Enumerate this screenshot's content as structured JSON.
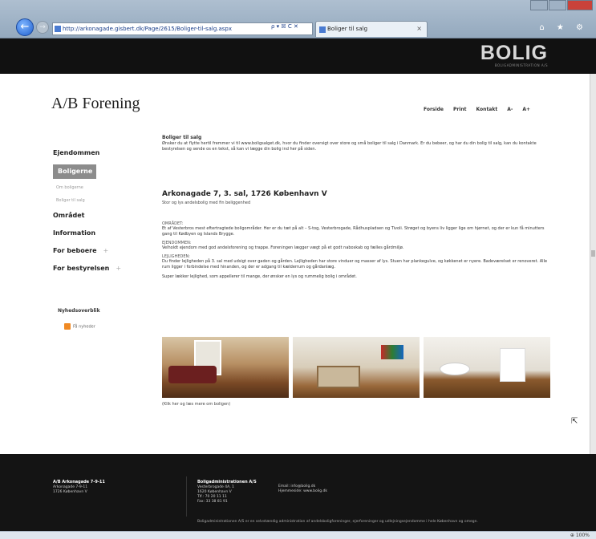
{
  "browser": {
    "back_icon": "back-arrow-icon",
    "forward_icon": "forward-arrow-icon",
    "url": "http://arkonagade.gisbert.dk/Page/2615/Boliger-til-salg.aspx",
    "address_controls": "ρ ▾ ☒ C ✕",
    "tab_title": "Boliger til salg",
    "tab_close": "×",
    "tools": "⌂ ★ ⚙",
    "zoom": "⊕ 100%"
  },
  "header": {
    "brand": "BOLIG",
    "brand_sub": "BOLIGADMINISTRATION A/S"
  },
  "site": {
    "title": "A/B Forening",
    "topnav": [
      "Forside",
      "Print",
      "Kontakt",
      "A-",
      "A+"
    ]
  },
  "sidebar": {
    "items": [
      {
        "label": "Ejendommen",
        "type": "item"
      },
      {
        "label": "Boligerne",
        "type": "active"
      },
      {
        "label": "Om boligerne",
        "type": "sub"
      },
      {
        "label": "Boliger til salg",
        "type": "sub"
      },
      {
        "label": "Området",
        "type": "item"
      },
      {
        "label": "Information",
        "type": "item"
      },
      {
        "label": "For beboere",
        "type": "item",
        "plus": "+"
      },
      {
        "label": "For bestyrelsen",
        "type": "item",
        "plus": "+"
      }
    ],
    "section_title": "Nyhedsoverblik",
    "rss_label": "Få nyheder"
  },
  "content": {
    "intro_title": "Boliger til salg",
    "intro_text": "Ønsker du at flytte hertil fremmer vi til www.boligsalget.dk, hvor du finder oversigt over store og små boliger til salg i Danmark. Er du bebeer, og har du din bolig til salg, kan du kontakte bestyrelsen og sende os en tekst, så kan vi lægge din bolig ind her på siden.",
    "address_title": "Arkonagade 7, 3. sal, 1726 København V",
    "address_sub": "Stor og lys andelsbolig med fin beliggenhed",
    "sections": [
      {
        "label": "OMRÅDET:",
        "text": "Et af Vesterbros mest eftertragtede boligområder. Her er du tæt på alt – S-tog, Vesterbrogade, Rådhuspladsen og Tivoli. Strøget og byens liv ligger lige om hjørnet, og der er kun få minutters gang til Kødbyen og Islands Brygge."
      },
      {
        "label": "EJENDOMMEN:",
        "text": "Velholdt ejendom med god andelsforening og trappe. Foreningen lægger vægt på et godt naboskab og fælles gårdmiljø."
      },
      {
        "label": "LEJLIGHEDEN:",
        "text": "Du finder lejligheden på 3. sal med udsigt over gaden og gården. Lejligheden har store vinduer og masser af lys. Stuen har plankegulve, og køkkenet er nyere. Badeværelset er renoveret. Alle rum ligger i forbindelse med hinanden, og der er adgang til kælderrum og gårdanlæg."
      }
    ],
    "closing": "Super lækker lejlighed, som appellerer til mange, der ønsker en lys og rummelig bolig i området.",
    "photo_caption": "(Klik her og læs mere om boligen)"
  },
  "footer": {
    "col1": [
      "A/B Arkonagade 7-9-11",
      "Arkonagade 7-9-11",
      "1726 København V"
    ],
    "col2": [
      "Boligadministrationen A/S",
      "Vesterbrogade 4A, 1",
      "1620 København V",
      "Tlf.: 70 20 11 11",
      "Fax: 33 38 81 91"
    ],
    "col3": [
      "Email: info@bolig.dk",
      "Hjemmeside: www.bolig.dk"
    ],
    "bottom": "Boligadministrationen A/S er en selvstændig administration af andelsboligforeninger, ejerforeninger og udlejningsejendomme i hele København og omegn."
  }
}
